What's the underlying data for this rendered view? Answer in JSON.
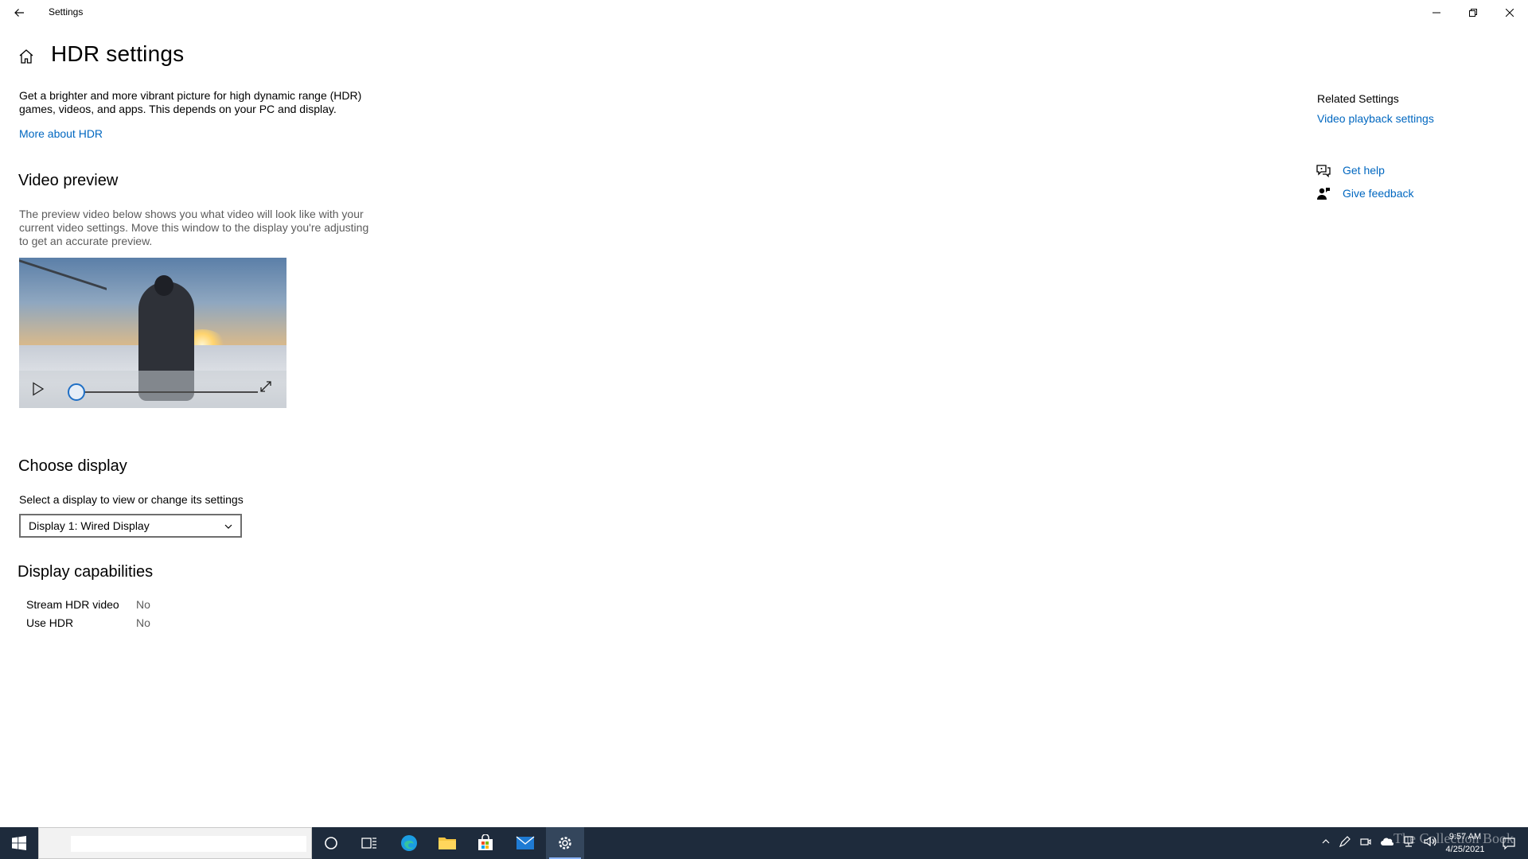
{
  "window": {
    "title": "Settings"
  },
  "page": {
    "title": "HDR settings",
    "description": "Get a brighter and more vibrant picture for high dynamic range (HDR) games, videos, and apps. This depends on your PC and display.",
    "more_link": "More about HDR"
  },
  "video_preview": {
    "heading": "Video preview",
    "description": "The preview video below shows you what video will look like with your current video settings. Move this window to the display you're adjusting to get an accurate preview.",
    "progress": 0.0
  },
  "choose_display": {
    "heading": "Choose display",
    "label": "Select a display to view or change its settings",
    "selected": "Display 1: Wired Display"
  },
  "capabilities": {
    "heading": "Display capabilities",
    "rows": [
      {
        "label": "Stream HDR video",
        "value": "No"
      },
      {
        "label": "Use HDR",
        "value": "No"
      }
    ]
  },
  "related": {
    "heading": "Related Settings",
    "links": [
      "Video playback settings"
    ]
  },
  "support": {
    "get_help": "Get help",
    "give_feedback": "Give feedback"
  },
  "taskbar": {
    "time": "9:57 AM",
    "date": "4/25/2021",
    "watermark": "The Collection Book",
    "icons": [
      "start-icon",
      "search-box",
      "cortana-icon",
      "task-view-icon",
      "edge-icon",
      "file-explorer-icon",
      "store-icon",
      "mail-icon",
      "settings-icon"
    ]
  },
  "colors": {
    "accent": "#0067c0",
    "taskbar": "#1e2b3c"
  }
}
